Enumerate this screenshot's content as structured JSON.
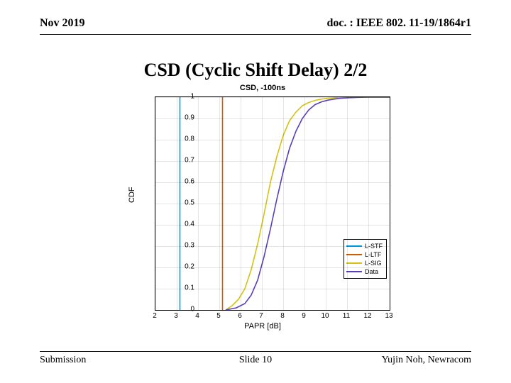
{
  "header": {
    "date": "Nov 2019",
    "docnum": "doc. : IEEE 802. 11-19/1864r1"
  },
  "title": "CSD (Cyclic Shift Delay) 2/2",
  "footer": {
    "left": "Submission",
    "center": "Slide 10",
    "right": "Yujin Noh, Newracom"
  },
  "chart_data": {
    "type": "line",
    "title": "CSD, -100ns",
    "xlabel": "PAPR [dB]",
    "ylabel": "CDF",
    "xlim": [
      2,
      13
    ],
    "ylim": [
      0,
      1
    ],
    "xticks": [
      2,
      3,
      4,
      5,
      6,
      7,
      8,
      9,
      10,
      11,
      12,
      13
    ],
    "yticks": [
      0,
      0.1,
      0.2,
      0.3,
      0.4,
      0.5,
      0.6,
      0.7,
      0.8,
      0.9,
      1
    ],
    "legend_position": "lower-right",
    "marker_lines": [
      {
        "name": "L-STF",
        "color": "#00a0e8",
        "x": 3.15
      },
      {
        "name": "L-LTF",
        "color": "#d15c00",
        "x": 5.15
      },
      {
        "name": "L-SIG",
        "color": "#d6c214",
        "x_start": 5.3
      }
    ],
    "series": [
      {
        "name": "L-SIG",
        "color": "#d6c214",
        "x": [
          5.3,
          5.6,
          5.9,
          6.2,
          6.5,
          6.8,
          7.1,
          7.4,
          7.7,
          8.0,
          8.3,
          8.6,
          8.9,
          9.2,
          9.5,
          9.8,
          10.1,
          10.4,
          10.7,
          11.0,
          11.5
        ],
        "cdf": [
          0.0,
          0.02,
          0.05,
          0.1,
          0.19,
          0.31,
          0.45,
          0.6,
          0.72,
          0.82,
          0.89,
          0.93,
          0.96,
          0.975,
          0.985,
          0.991,
          0.995,
          0.997,
          0.999,
          1.0,
          1.0
        ]
      },
      {
        "name": "Data",
        "color": "#5a3fbd",
        "x": [
          5.3,
          5.8,
          6.2,
          6.5,
          6.8,
          7.1,
          7.4,
          7.7,
          8.0,
          8.3,
          8.6,
          8.9,
          9.2,
          9.5,
          9.8,
          10.1,
          10.4,
          10.7,
          11.0,
          11.5,
          12.0,
          12.5,
          13.0
        ],
        "cdf": [
          0.0,
          0.01,
          0.03,
          0.07,
          0.14,
          0.25,
          0.38,
          0.52,
          0.65,
          0.76,
          0.84,
          0.9,
          0.94,
          0.965,
          0.978,
          0.986,
          0.991,
          0.995,
          0.997,
          0.999,
          1.0,
          1.0,
          1.0
        ]
      }
    ],
    "legend": [
      {
        "label": "L-STF",
        "color": "#00a0e8"
      },
      {
        "label": "L-LTF",
        "color": "#d15c00"
      },
      {
        "label": "L-SIG",
        "color": "#d6c214"
      },
      {
        "label": "Data",
        "color": "#5a3fbd"
      }
    ]
  }
}
